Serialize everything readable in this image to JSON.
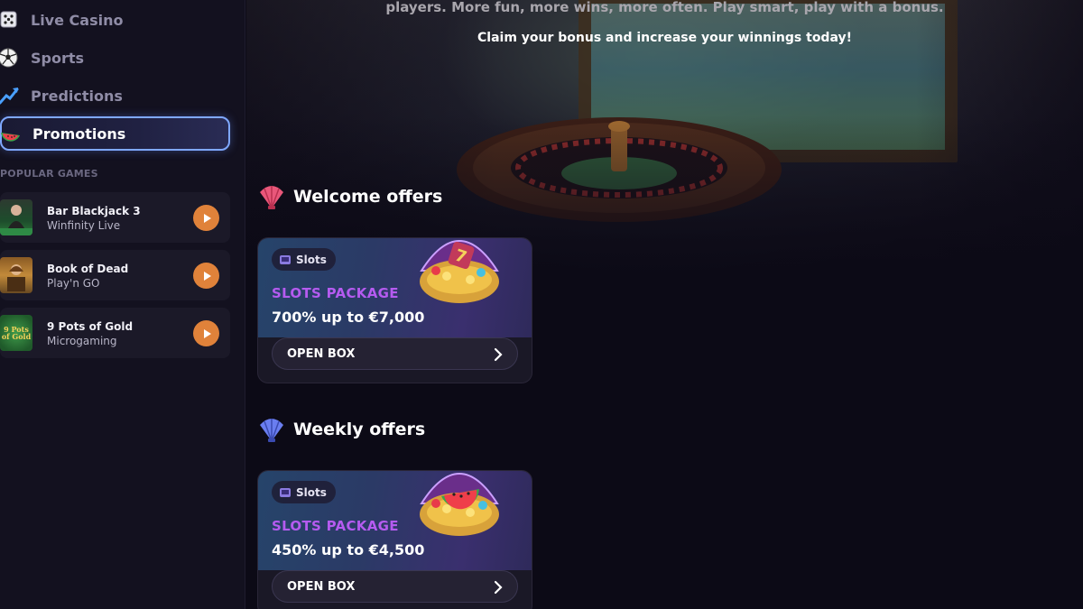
{
  "sidebar": {
    "nav": [
      {
        "label": "Live Casino",
        "icon": "dice-icon",
        "active": false
      },
      {
        "label": "Sports",
        "icon": "soccer-ball-icon",
        "active": false
      },
      {
        "label": "Predictions",
        "icon": "trend-up-icon",
        "active": false
      },
      {
        "label": "Promotions",
        "icon": "watermelon-icon",
        "active": true
      }
    ],
    "popular_label": "POPULAR GAMES",
    "games": [
      {
        "title": "Bar Blackjack 3",
        "provider": "Winfinity Live"
      },
      {
        "title": "Book of Dead",
        "provider": "Play'n GO"
      },
      {
        "title": "9 Pots of Gold",
        "provider": "Microgaming",
        "thumb_text": "9 Pots of Gold"
      }
    ]
  },
  "hero": {
    "line1": "players. More fun, more wins, more often. Play smart, play with a bonus.",
    "line2": "Claim your bonus and increase your winnings today!"
  },
  "sections": [
    {
      "title": "Welcome offers",
      "icon": "pink-shell-icon",
      "offer": {
        "badge": "Slots",
        "label": "SLOTS PACKAGE",
        "value": "700% up to €7,000",
        "button": "OPEN BOX"
      }
    },
    {
      "title": "Weekly offers",
      "icon": "blue-shell-icon",
      "offer": {
        "badge": "Slots",
        "label": "SLOTS PACKAGE",
        "value": "450% up to €4,500",
        "button": "OPEN BOX"
      }
    }
  ],
  "colors": {
    "accent_play": "#e0823a",
    "active_border": "#7fa8ff",
    "package_label": "#b55bf0"
  }
}
